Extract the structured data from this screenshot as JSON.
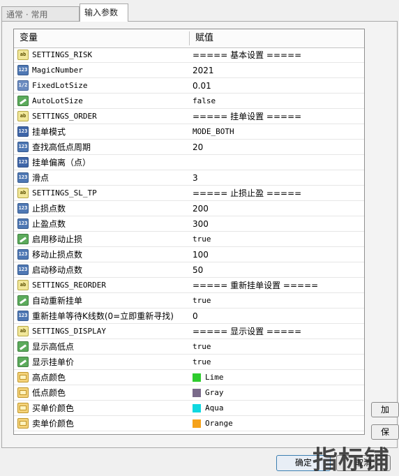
{
  "tabs": [
    {
      "label": "通常 · 常用"
    },
    {
      "label": "输入参数"
    }
  ],
  "grid": {
    "header": {
      "variable": "变量",
      "value": "赋值"
    },
    "rows": [
      {
        "icon": "string-icon",
        "code": "ab",
        "name": "SETTINGS_RISK",
        "value": "===== 基本设置 ====="
      },
      {
        "icon": "integer-icon",
        "code": "123",
        "name": "MagicNumber",
        "value": "2021"
      },
      {
        "icon": "double-icon",
        "code": "1/2",
        "name": "FixedLotSize",
        "value": "0.01"
      },
      {
        "icon": "bool-icon",
        "code": "",
        "name": "AutoLotSize",
        "value": "false"
      },
      {
        "icon": "string-icon",
        "code": "ab",
        "name": "SETTINGS_ORDER",
        "value": "===== 挂单设置 ====="
      },
      {
        "icon": "enum-icon",
        "code": "123",
        "name": "挂单模式",
        "value": "MODE_BOTH"
      },
      {
        "icon": "integer-icon",
        "code": "123",
        "name": "查找高低点周期",
        "value": "20"
      },
      {
        "icon": "enum-icon",
        "code": "123",
        "name": "挂单偏离（点）",
        "value": ""
      },
      {
        "icon": "integer-icon",
        "code": "123",
        "name": "滑点",
        "value": "3"
      },
      {
        "icon": "string-icon",
        "code": "ab",
        "name": "SETTINGS_SL_TP",
        "value": "===== 止损止盈 ====="
      },
      {
        "icon": "integer-icon",
        "code": "123",
        "name": "止损点数",
        "value": "200"
      },
      {
        "icon": "integer-icon",
        "code": "123",
        "name": "止盈点数",
        "value": "300"
      },
      {
        "icon": "bool-icon",
        "code": "",
        "name": "启用移动止损",
        "value": "true"
      },
      {
        "icon": "integer-icon",
        "code": "123",
        "name": "移动止损点数",
        "value": "100"
      },
      {
        "icon": "integer-icon",
        "code": "123",
        "name": "启动移动点数",
        "value": "50"
      },
      {
        "icon": "string-icon",
        "code": "ab",
        "name": "SETTINGS_REORDER",
        "value": "===== 重新挂单设置 ====="
      },
      {
        "icon": "bool-icon",
        "code": "",
        "name": "自动重新挂单",
        "value": "true"
      },
      {
        "icon": "integer-icon",
        "code": "123",
        "name": "重新挂单等待K线数(0=立即重新寻找)",
        "value": "0"
      },
      {
        "icon": "string-icon",
        "code": "ab",
        "name": "SETTINGS_DISPLAY",
        "value": "===== 显示设置 ====="
      },
      {
        "icon": "bool-icon",
        "code": "",
        "name": "显示高低点",
        "value": "true"
      },
      {
        "icon": "bool-icon",
        "code": "",
        "name": "显示挂单价",
        "value": "true"
      },
      {
        "icon": "color-icon",
        "code": "",
        "name": "高点颜色",
        "value": "Lime",
        "swatch": "#2ecc2e"
      },
      {
        "icon": "color-icon",
        "code": "",
        "name": "低点颜色",
        "value": "Gray",
        "swatch": "#7a6a8a"
      },
      {
        "icon": "color-icon",
        "code": "",
        "name": "买单价颜色",
        "value": "Aqua",
        "swatch": "#10d8e0"
      },
      {
        "icon": "color-icon",
        "code": "",
        "name": "卖单价颜色",
        "value": "Orange",
        "swatch": "#f5a21a"
      }
    ]
  },
  "side_buttons": [
    {
      "label": "加"
    },
    {
      "label": "保"
    }
  ],
  "buttons": {
    "ok": "确定",
    "cancel": "取消"
  },
  "watermark": "指标铺"
}
